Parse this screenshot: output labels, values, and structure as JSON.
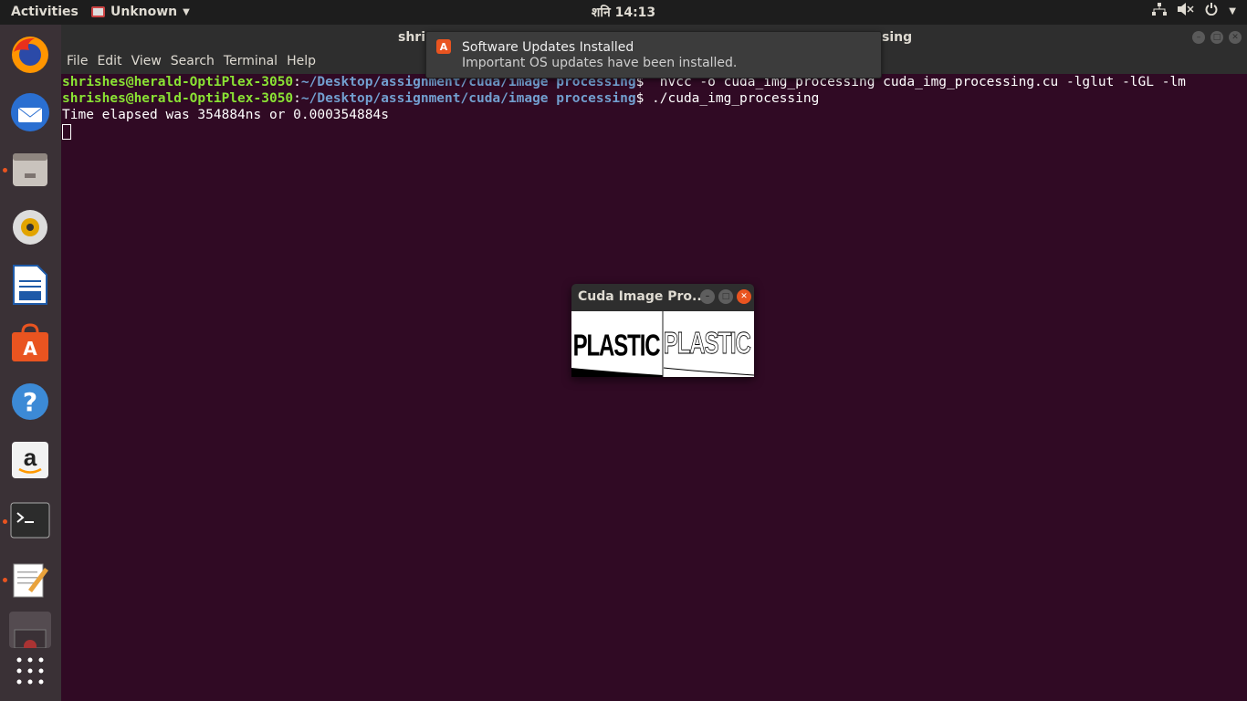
{
  "top_panel": {
    "activities": "Activities",
    "app_name": "Unknown",
    "clock": "शनि 14:13"
  },
  "dock": {
    "items": [
      {
        "name": "firefox"
      },
      {
        "name": "thunderbird"
      },
      {
        "name": "files"
      },
      {
        "name": "rhythmbox"
      },
      {
        "name": "libreoffice-writer"
      },
      {
        "name": "ubuntu-software"
      },
      {
        "name": "help"
      },
      {
        "name": "amazon"
      },
      {
        "name": "terminal"
      },
      {
        "name": "text-editor"
      },
      {
        "name": "screenshot"
      }
    ]
  },
  "terminal": {
    "title_start": "shris",
    "title_end": "sing",
    "menu": [
      "File",
      "Edit",
      "View",
      "Search",
      "Terminal",
      "Help"
    ],
    "lines": [
      {
        "user": "shrishes@herald-OptiPlex-3050",
        "path": "~/Desktop/assignment/cuda/image processing",
        "cmd": "$  nvcc -o cuda_img_processing cuda_img_processing.cu -lglut -lGL -lm"
      },
      {
        "user": "shrishes@herald-OptiPlex-3050",
        "path": "~/Desktop/assignment/cuda/image processing",
        "cmd": "$ ./cuda_img_processing"
      }
    ],
    "output": "Time elapsed was 354884ns or 0.000354884s"
  },
  "notification": {
    "title": "Software Updates Installed",
    "body": "Important OS updates have been installed."
  },
  "cuda_window": {
    "title": "Cuda Image Pro...",
    "image_left_text": "PLASTIC",
    "image_right_text": "PLASTIC"
  },
  "colors": {
    "terminal_bg": "#300a24",
    "prompt_user": "#8ae234",
    "prompt_path": "#729fcf",
    "accent": "#e95420"
  }
}
